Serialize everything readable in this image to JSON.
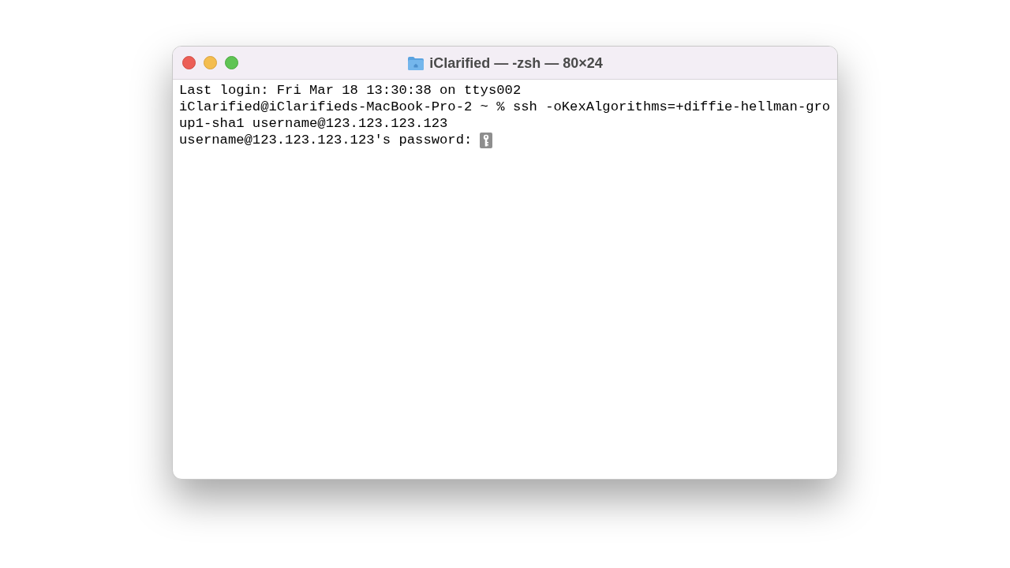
{
  "window": {
    "title": "iClarified — -zsh — 80×24"
  },
  "terminal": {
    "lines": [
      "Last login: Fri Mar 18 13:30:38 on ttys002",
      "iClarified@iClarifieds-MacBook-Pro-2 ~ % ssh -oKexAlgorithms=+diffie-hellman-gro",
      "up1-sha1 username@123.123.123.123",
      "username@123.123.123.123's password: "
    ],
    "password_prompt": true
  }
}
